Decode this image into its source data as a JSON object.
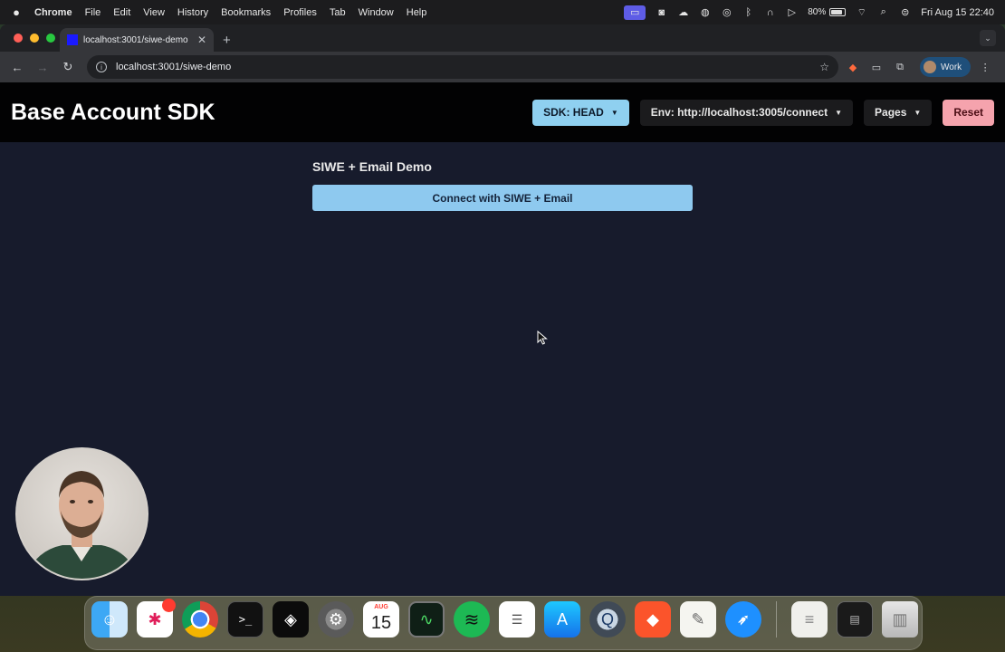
{
  "menubar": {
    "app_name": "Chrome",
    "menus": [
      "File",
      "Edit",
      "View",
      "History",
      "Bookmarks",
      "Profiles",
      "Tab",
      "Window",
      "Help"
    ],
    "battery_percent": "80%",
    "datetime": "Fri Aug 15  22:40"
  },
  "browser": {
    "tab_title": "localhost:3001/siwe-demo",
    "url": "localhost:3001/siwe-demo",
    "profile_label": "Work"
  },
  "app": {
    "title": "Base Account SDK",
    "sdk_label": "SDK: HEAD",
    "env_label": "Env: http://localhost:3005/connect",
    "pages_label": "Pages",
    "reset_label": "Reset",
    "demo_title": "SIWE + Email Demo",
    "connect_label": "Connect with SIWE + Email"
  },
  "dock": {
    "calendar_month": "AUG",
    "calendar_day": "15",
    "apps": [
      "finder",
      "slack",
      "chrome",
      "terminal",
      "cursor",
      "system-settings",
      "calendar",
      "activity-monitor",
      "spotify",
      "reminders",
      "app-store",
      "quicktime",
      "brave",
      "textedit",
      "safari",
      "document",
      "screenshot",
      "trash"
    ]
  },
  "colors": {
    "header_bg": "#020203",
    "content_bg": "#171b2c",
    "sdk_button": "#8fd0f0",
    "reset_button": "#f5a3ad",
    "connect_button": "#8ec9ef"
  }
}
